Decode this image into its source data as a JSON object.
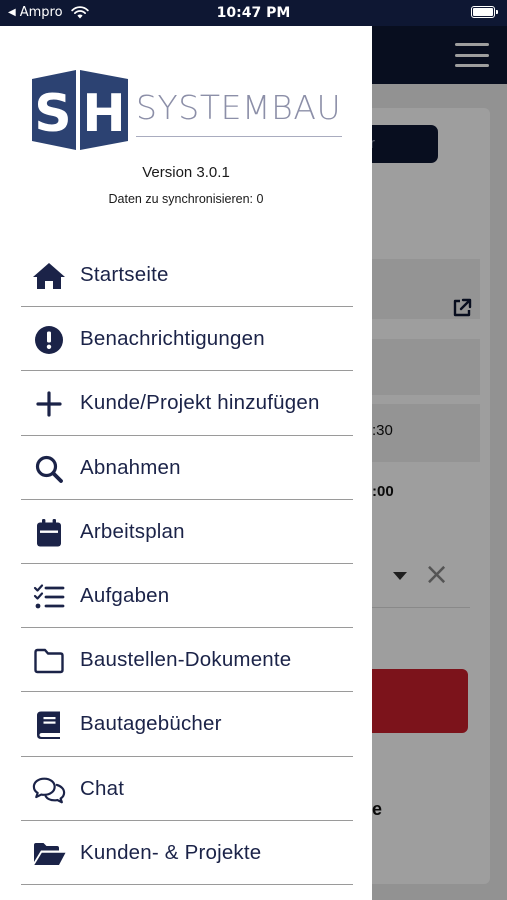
{
  "status_bar": {
    "back_label": "Ampro",
    "time": "10:47 PM",
    "icons": [
      "back-arrow-icon",
      "wifi-icon",
      "battery-icon"
    ]
  },
  "logo": {
    "letters": "SH",
    "wordmark": "SYSTEMBAU"
  },
  "drawer": {
    "version": "Version 3.0.1",
    "sync_status": "Daten zu synchronisieren: 0"
  },
  "menu": [
    {
      "label": "Startseite",
      "icon": "home-icon"
    },
    {
      "label": "Benachrichtigungen",
      "icon": "alert-circle-icon"
    },
    {
      "label": "Kunde/Projekt hinzufügen",
      "icon": "plus-icon"
    },
    {
      "label": "Abnahmen",
      "icon": "search-icon"
    },
    {
      "label": "Arbeitsplan",
      "icon": "calendar-icon"
    },
    {
      "label": "Aufgaben",
      "icon": "task-list-icon"
    },
    {
      "label": "Baustellen-Dokumente",
      "icon": "folder-outline-icon"
    },
    {
      "label": "Bautagebücher",
      "icon": "book-icon"
    },
    {
      "label": "Chat",
      "icon": "chat-bubbles-icon"
    },
    {
      "label": "Kunden- & Projekte",
      "icon": "folder-open-icon"
    }
  ],
  "background": {
    "button_fragment": "r",
    "time_fragment_1": ":30",
    "time_fragment_2": ":00",
    "text_fragment": "e"
  },
  "colors": {
    "navy": "#0e1733",
    "menu_text": "#1b2348",
    "logo_blue": "#2c4272",
    "logo_gray": "#8c8fa8",
    "danger": "#c9202c"
  }
}
